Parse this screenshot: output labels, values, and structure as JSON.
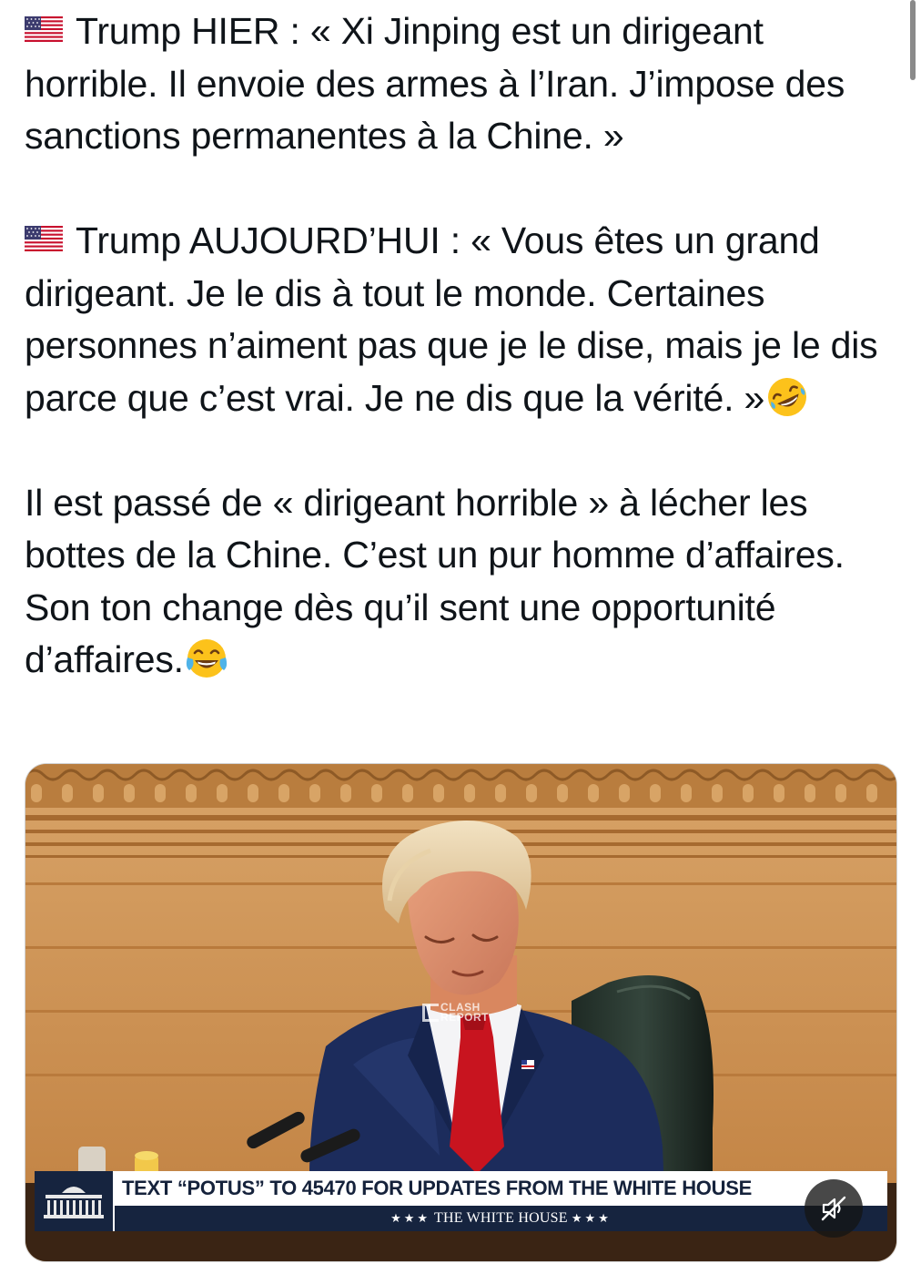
{
  "tweet": {
    "paragraph1_flag": "us-flag-icon",
    "paragraph1": "Trump HIER : « Xi Jinping est un dirigeant horrible. Il envoie des armes à l’Iran. J’impose des sanctions permanentes à la Chine. »",
    "paragraph2_flag": "us-flag-icon",
    "paragraph2": "Trump AUJOURD’HUI : « Vous êtes un grand dirigeant. Je le dis à tout le monde. Certaines personnes n’aiment pas que je le dise, mais je le dis parce que c’est vrai. Je ne dis que la vérité. »",
    "paragraph2_emoji": "rolling-on-floor-laughing-emoji",
    "paragraph3": "Il est passé de « dirigeant horrible » à lécher les bottes de la Chine. C’est un pur homme d’affaires. Son ton change dès qu’il sent une opportunité d’affaires.",
    "paragraph3_emoji": "tears-of-joy-emoji"
  },
  "media": {
    "watermark_line1": "CLASH",
    "watermark_line2": "REPORT",
    "banner_text": "TEXT “POTUS” TO 45470 FOR UPDATES FROM THE WHITE HOUSE",
    "banner_stars_left": "★★★",
    "banner_subtext": "THE WHITE HOUSE",
    "banner_stars_right": "★★★",
    "mute_icon": "muted-speaker-icon"
  },
  "colors": {
    "banner_navy": "#16243f",
    "tie_red": "#c8141f",
    "suit_navy": "#1c2c5c"
  }
}
